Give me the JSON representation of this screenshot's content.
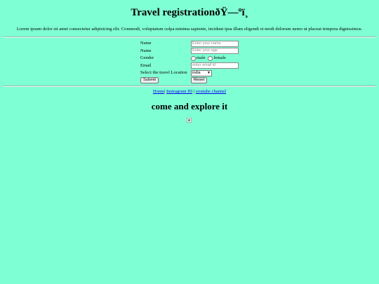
{
  "header": {
    "title": "Travel registrationðŸ—ºï¸",
    "intro": "Lorem ipsum dolor sit amet consectetur adipisicing elit. Commodi, voluptatum culpa minima sapiente, incidunt ipsa illum eligendi et modi dolorum nemo ut placeat tempora dignissimos."
  },
  "form": {
    "name_label": "Name",
    "name_placeholder": "Enter your name",
    "age_label": "Name",
    "age_placeholder": "Enter your age",
    "gender_label": "Gender",
    "gender_options": [
      "male",
      "female"
    ],
    "email_label": "Email",
    "email_placeholder": "enter email id",
    "location_label": "Select the travel Location",
    "location_selected": "india",
    "submit_label": "Submit",
    "reset_label": "Reset"
  },
  "links": {
    "home": "Home",
    "instagram": "Instragram ID",
    "youtube": "youtube channel",
    "separator": "|"
  },
  "main": {
    "heading": "come and explore it"
  },
  "colors": {
    "background": "#7fffd4",
    "link": "#0000ee"
  }
}
